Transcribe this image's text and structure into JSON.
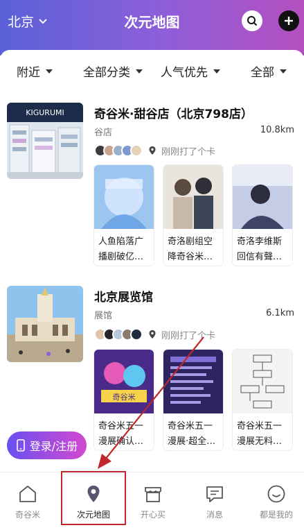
{
  "header": {
    "city": "北京",
    "title": "次元地图"
  },
  "filters": [
    "附近",
    "全部分类",
    "人气优先",
    "全部"
  ],
  "places": [
    {
      "name": "奇谷米·甜谷店（北京798店）",
      "category": "谷店",
      "distance": "10.8km",
      "checkin_text": "刚刚打了个卡",
      "cover_text": "KIGURUMI",
      "posts": [
        {
          "caption": "人鱼陷落广播剧破亿…"
        },
        {
          "caption": "奇洛剧组空降奇谷米…"
        },
        {
          "caption": "奇洛李维斯回信有聲…"
        }
      ]
    },
    {
      "name": "北京展览馆",
      "category": "展馆",
      "distance": "6.1km",
      "checkin_text": "刚刚打了个卡",
      "posts": [
        {
          "caption": "奇谷米五一漫展确认…",
          "image_text": "奇谷米"
        },
        {
          "caption": "奇谷米五一漫展·超全…"
        },
        {
          "caption": "奇谷米五一漫展无料…"
        }
      ]
    }
  ],
  "login_label": "登录/注册",
  "tabs": [
    {
      "label": "奇谷米"
    },
    {
      "label": "次元地图"
    },
    {
      "label": "开心买"
    },
    {
      "label": "消息"
    },
    {
      "label": "都是我的"
    }
  ],
  "colors": {
    "accent_red": "#c0262c",
    "header_left": "#5a61d8",
    "header_right": "#b44fc0"
  }
}
